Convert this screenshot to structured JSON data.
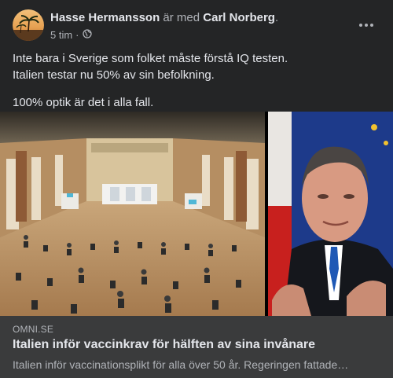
{
  "post": {
    "author": "Hasse Hermansson",
    "with_text": "är med",
    "tagged": "Carl Norberg",
    "punct": ".",
    "time": "5 tim",
    "separator": "·",
    "privacy_icon": "globe-icon",
    "more_icon": "more-horizontal-icon",
    "text_line1": "Inte bara i Sverige som folket måste förstå IQ testen.",
    "text_line2": "Italien testar nu 50% av sin befolkning.",
    "text_line3": "100% optik är det i alla fall."
  },
  "link_preview": {
    "domain": "OMNI.SE",
    "title": "Italien inför vaccinkrav för hälften av sina invånare",
    "description": "Italien inför vaccinationsplikt för alla över 50 år. Regeringen fattade…"
  },
  "colors": {
    "background": "#242526",
    "link_box": "#3a3b3c",
    "text_primary": "#e4e6eb",
    "text_secondary": "#b0b3b8"
  }
}
